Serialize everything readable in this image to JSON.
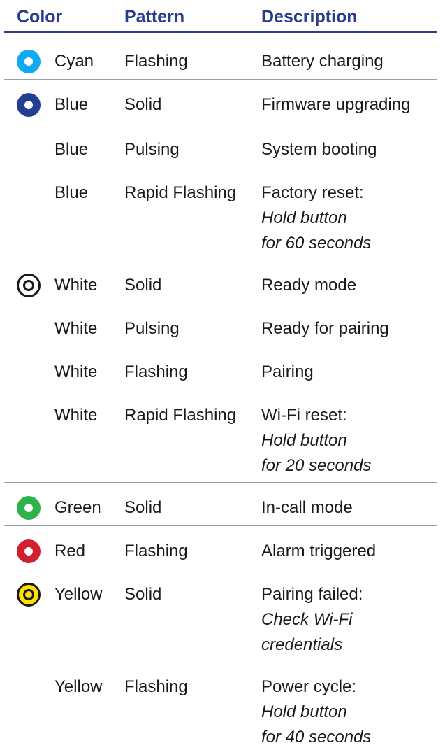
{
  "headers": {
    "color": "Color",
    "pattern": "Pattern",
    "description": "Description"
  },
  "groups": [
    {
      "led": {
        "name": "cyan-led-icon",
        "fill": "#11aaf0",
        "ring": "none"
      },
      "rows": [
        {
          "color": "Cyan",
          "pattern": "Flashing",
          "description": "Battery charging"
        }
      ]
    },
    {
      "led": {
        "name": "blue-led-icon",
        "fill": "#243e91",
        "ring": "none"
      },
      "rows": [
        {
          "color": "Blue",
          "pattern": "Solid",
          "description": "Firmware upgrading"
        },
        {
          "color": "Blue",
          "pattern": "Pulsing",
          "description": "System booting"
        },
        {
          "color": "Blue",
          "pattern": "Rapid Flashing",
          "description": "Factory reset:",
          "note_lines": [
            "Hold button",
            "for 60 seconds"
          ]
        }
      ]
    },
    {
      "led": {
        "name": "white-led-icon",
        "fill": "#ffffff",
        "ring": "#1a1a1a"
      },
      "rows": [
        {
          "color": "White",
          "pattern": "Solid",
          "description": "Ready mode"
        },
        {
          "color": "White",
          "pattern": "Pulsing",
          "description": "Ready for pairing"
        },
        {
          "color": "White",
          "pattern": "Flashing",
          "description": "Pairing"
        },
        {
          "color": "White",
          "pattern": "Rapid Flashing",
          "description": "Wi-Fi reset:",
          "note_lines": [
            "Hold button",
            "for 20 seconds"
          ]
        }
      ]
    },
    {
      "led": {
        "name": "green-led-icon",
        "fill": "#2fb24a",
        "ring": "none"
      },
      "rows": [
        {
          "color": "Green",
          "pattern": "Solid",
          "description": "In-call mode"
        }
      ]
    },
    {
      "led": {
        "name": "red-led-icon",
        "fill": "#d3202e",
        "ring": "none"
      },
      "rows": [
        {
          "color": "Red",
          "pattern": "Flashing",
          "description": "Alarm triggered"
        }
      ]
    },
    {
      "led": {
        "name": "yellow-led-icon",
        "fill": "#ffe100",
        "ring": "#1a1a1a"
      },
      "rows": [
        {
          "color": "Yellow",
          "pattern": "Solid",
          "description": "Pairing failed:",
          "note_lines": [
            "Check Wi-Fi",
            "credentials"
          ]
        },
        {
          "color": "Yellow",
          "pattern": "Flashing",
          "description": "Power cycle:",
          "note_lines": [
            "Hold button",
            "for 40 seconds"
          ]
        }
      ]
    }
  ]
}
